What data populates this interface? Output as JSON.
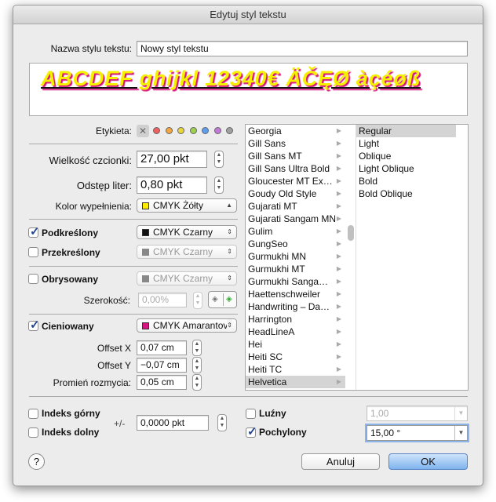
{
  "window": {
    "title": "Edytuj styl tekstu"
  },
  "name_field": {
    "label": "Nazwa stylu tekstu:",
    "value": "Nowy styl tekstu"
  },
  "preview": {
    "text": "ABCDEF ghijkl 12340€ ÄČĘØ àçéøß",
    "fill_color": "#f5f000",
    "shadow_color": "#d6157f"
  },
  "label_row": {
    "label": "Etykieta:",
    "colors": [
      "#f06060",
      "#f3a640",
      "#e8d63a",
      "#9ed14a",
      "#5c9ef0",
      "#c27ad6",
      "#a0a0a0"
    ]
  },
  "font_size": {
    "label": "Wielkość czcionki:",
    "value": "27,00 pkt"
  },
  "letter_spacing": {
    "label": "Odstęp liter:",
    "value": "0,80 pkt"
  },
  "fill_color": {
    "label": "Kolor wypełnienia:",
    "value": "CMYK Żółty",
    "swatch": "#ffee00"
  },
  "underline": {
    "label": "Podkreślony",
    "checked": true,
    "color": "CMYK Czarny",
    "swatch": "#111111"
  },
  "strikethrough": {
    "label": "Przekreślony",
    "checked": false,
    "color": "CMYK Czarny",
    "swatch": "#888888"
  },
  "outline": {
    "label": "Obrysowany",
    "checked": false,
    "color": "CMYK Czarny",
    "swatch": "#888888",
    "width_label": "Szerokość:",
    "width_value": "0,00%"
  },
  "shadow": {
    "label": "Cieniowany",
    "checked": true,
    "color": "CMYK Amarantov",
    "swatch": "#d6157f",
    "offset_x_label": "Offset X",
    "offset_x": "0,07 cm",
    "offset_y_label": "Offset Y",
    "offset_y": "−0,07 cm",
    "blur_label": "Promień rozmycia:",
    "blur": "0,05 cm"
  },
  "fonts": [
    "Georgia",
    "Gill Sans",
    "Gill Sans MT",
    "Gill Sans Ultra Bold",
    "Gloucester MT Ex…",
    "Goudy Old Style",
    "Gujarati MT",
    "Gujarati Sangam MN",
    "Gulim",
    "GungSeo",
    "Gurmukhi MN",
    "Gurmukhi MT",
    "Gurmukhi Sanga…",
    "Haettenschweiler",
    "Handwriting – Da…",
    "Harrington",
    "HeadLineA",
    "Hei",
    "Heiti SC",
    "Heiti TC",
    "Helvetica"
  ],
  "selected_font": "Helvetica",
  "styles": [
    "Regular",
    "Light",
    "Oblique",
    "Light Oblique",
    "Bold",
    "Bold Oblique"
  ],
  "selected_style": "Regular",
  "superscript": {
    "label": "Indeks górny",
    "checked": false
  },
  "subscript": {
    "label": "Indeks dolny",
    "checked": false
  },
  "baseline": {
    "label": "+/-",
    "value": "0,0000 pkt"
  },
  "loose": {
    "label": "Luźny",
    "checked": false,
    "value": "1,00"
  },
  "italic": {
    "label": "Pochylony",
    "checked": true,
    "value": "15,00 °"
  },
  "buttons": {
    "help": "?",
    "cancel": "Anuluj",
    "ok": "OK"
  }
}
